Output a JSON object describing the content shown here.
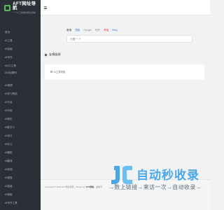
{
  "brand": {
    "title": "AFT网址导航",
    "subtitle": "一个人工智能的网址导航"
  },
  "sidebar": {
    "items": [
      {
        "label": "首页"
      },
      {
        "label": "AI工具"
      },
      {
        "label": "AI绘画"
      },
      {
        "label": "AI写作"
      },
      {
        "label": "AIGC工具"
      },
      {
        "label": "AI对话聊天"
      },
      {
        "label": "AI视频"
      },
      {
        "label": "AI学习网站"
      },
      {
        "label": "AI平台"
      },
      {
        "label": "AI代码"
      },
      {
        "label": "AI音乐"
      },
      {
        "label": "AI数字人"
      },
      {
        "label": "AI设计"
      },
      {
        "label": "AI办公"
      },
      {
        "label": "AI模型"
      },
      {
        "label": "AI翻译"
      },
      {
        "label": "AI检测"
      },
      {
        "label": "AI语音"
      },
      {
        "label": "AI智能"
      },
      {
        "label": "AI搜索"
      },
      {
        "label": "AI写作工具"
      }
    ]
  },
  "search": {
    "tabs": [
      "常用",
      "搜索",
      "Google",
      "知乎",
      "淘宝",
      "Bing"
    ],
    "placeholder": "百度一下"
  },
  "section": {
    "title": "友情链接"
  },
  "links": [
    {
      "label": "AI工具导航"
    }
  ],
  "footer": {
    "copyright_prefix": "Copyright © 2025 AFT网址导航 · Design by",
    "copyright_brand": "AFT网址",
    "copyright_suffix": "· 备案号"
  },
  "watermark": {
    "title": "自动秒收录",
    "subtitle": "→数上链接→来访一次→自动收录→"
  },
  "colors": {
    "sidebar_bg": "#2b2f36",
    "accent_green": "#5cb85c",
    "watermark_blue": "#4aa8e8"
  }
}
